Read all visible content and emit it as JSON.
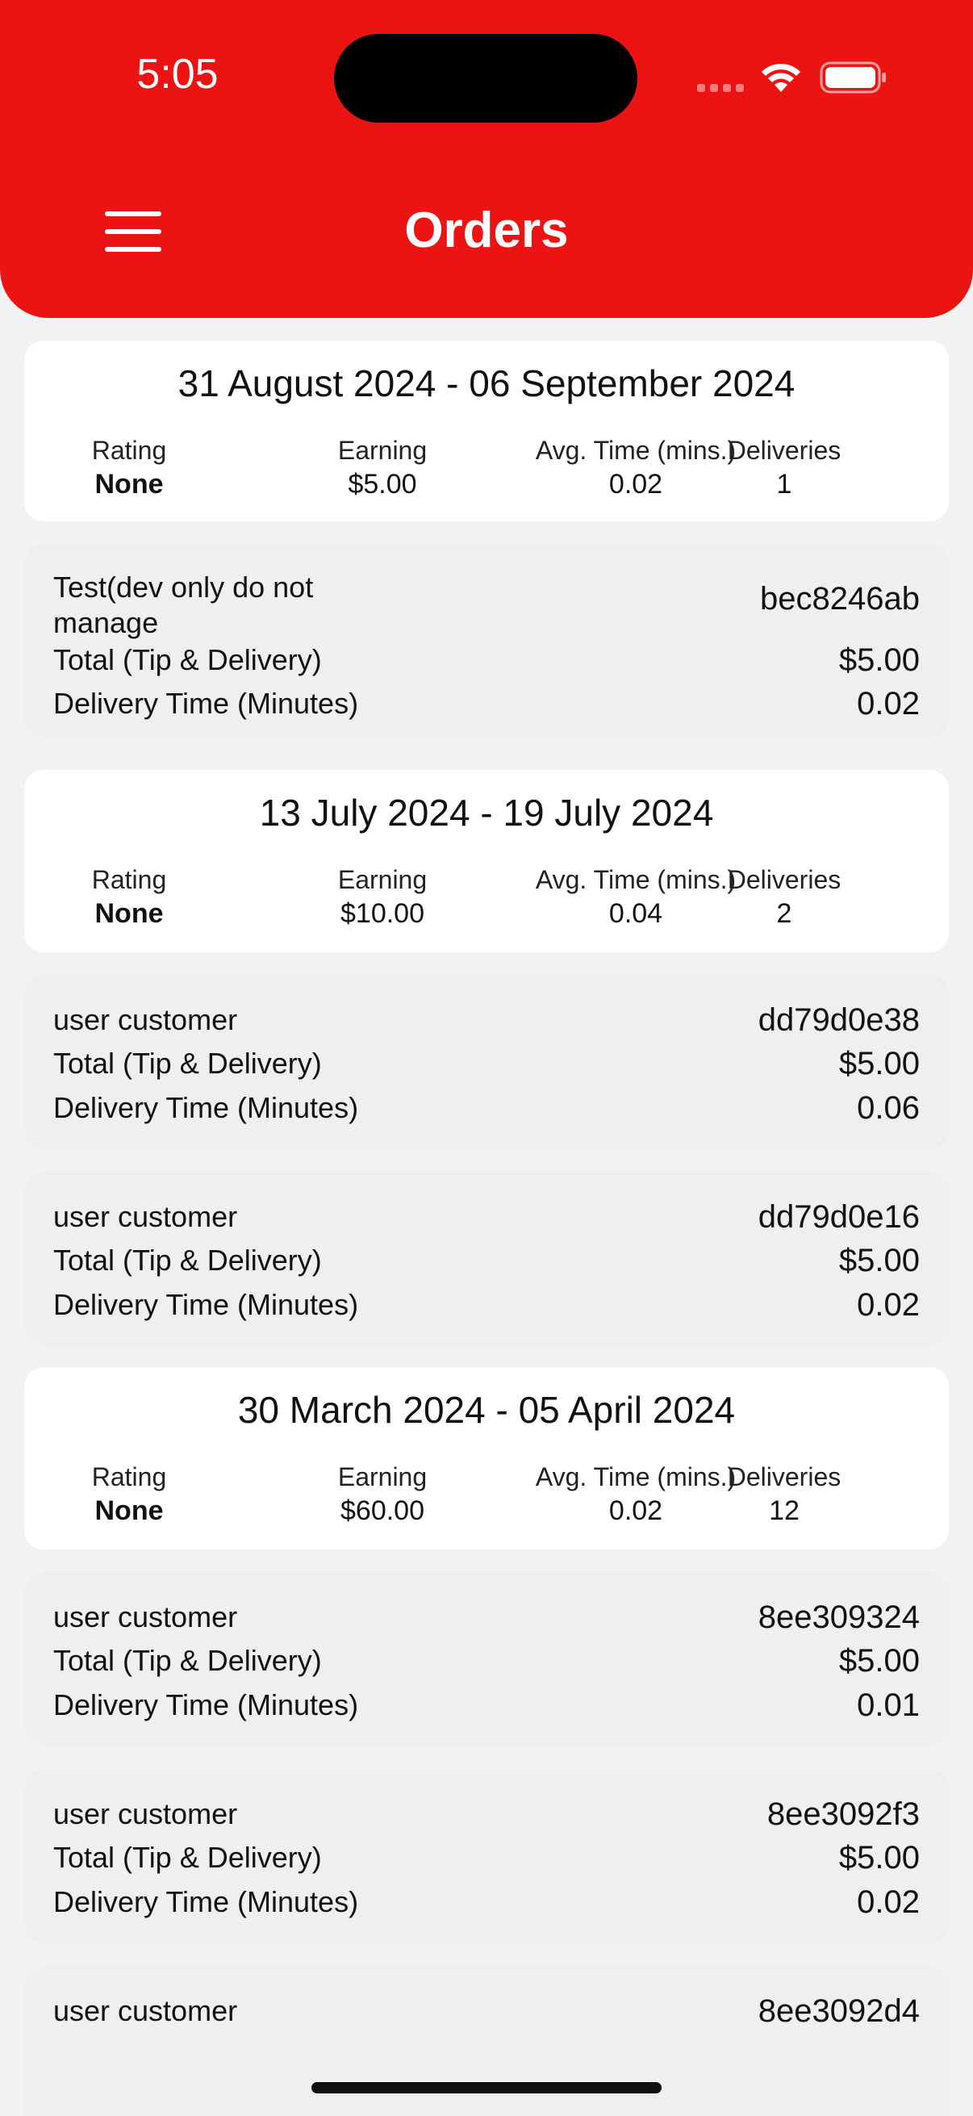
{
  "status_bar": {
    "time": "5:05"
  },
  "header": {
    "title": "Orders"
  },
  "stat_labels": {
    "rating": "Rating",
    "earning": "Earning",
    "avg_time": "Avg. Time (mins.)",
    "deliveries": "Deliveries"
  },
  "order_labels": {
    "total": "Total (Tip & Delivery)",
    "delivery_time": "Delivery Time (Minutes)"
  },
  "weeks": [
    {
      "range": "31 August 2024 - 06 September 2024",
      "rating": "None",
      "earning": "$5.00",
      "avg_time": "0.02",
      "deliveries": "1",
      "orders": [
        {
          "customer": "Test(dev only do not manage",
          "id": "bec8246ab",
          "total": "$5.00",
          "time": "0.02"
        }
      ]
    },
    {
      "range": "13 July 2024 - 19 July 2024",
      "rating": "None",
      "earning": "$10.00",
      "avg_time": "0.04",
      "deliveries": "2",
      "orders": [
        {
          "customer": "user customer",
          "id": "dd79d0e38",
          "total": "$5.00",
          "time": "0.06"
        },
        {
          "customer": "user customer",
          "id": "dd79d0e16",
          "total": "$5.00",
          "time": "0.02"
        }
      ]
    },
    {
      "range": "30 March 2024 - 05 April 2024",
      "rating": "None",
      "earning": "$60.00",
      "avg_time": "0.02",
      "deliveries": "12",
      "orders": [
        {
          "customer": "user customer",
          "id": "8ee309324",
          "total": "$5.00",
          "time": "0.01"
        },
        {
          "customer": "user customer",
          "id": "8ee3092f3",
          "total": "$5.00",
          "time": "0.02"
        },
        {
          "customer": "user customer",
          "id": "8ee3092d4"
        }
      ]
    }
  ]
}
